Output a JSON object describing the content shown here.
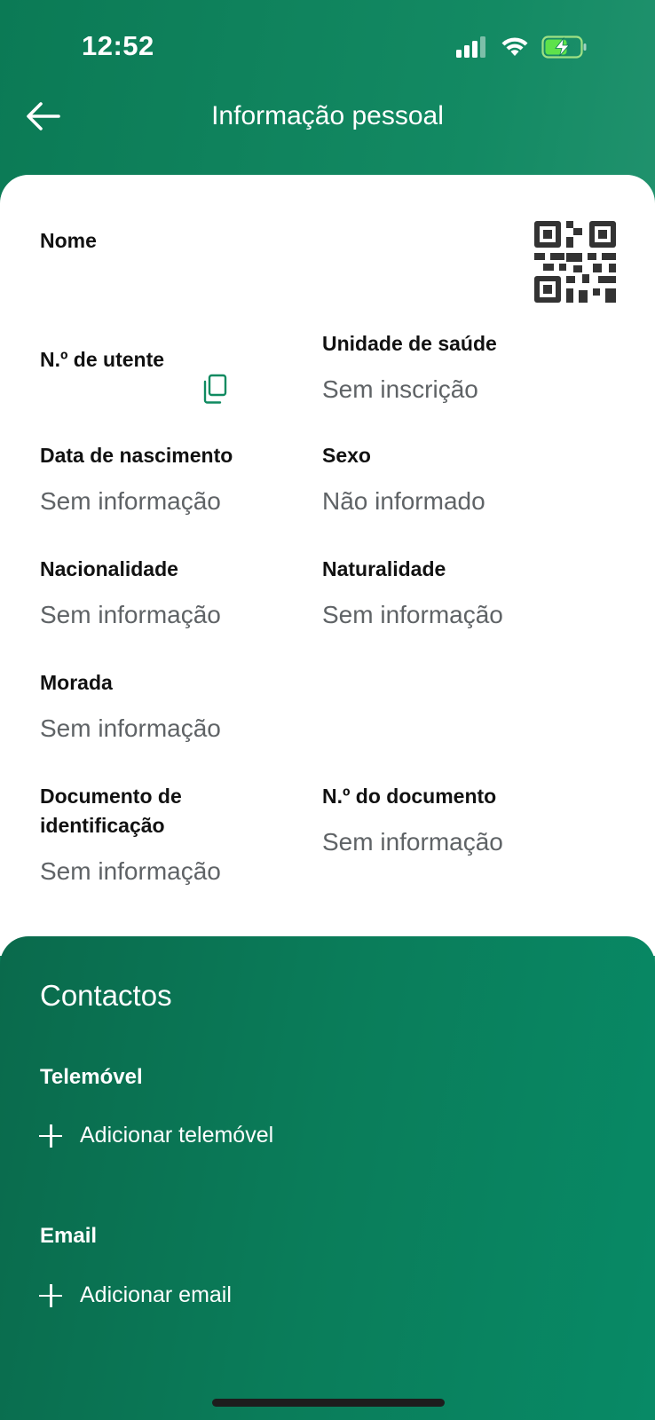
{
  "status_bar": {
    "time": "12:52",
    "icons": [
      "signal-icon",
      "wifi-icon",
      "battery-charging-icon"
    ]
  },
  "header": {
    "title": "Informação pessoal",
    "back_icon": "arrow-left-icon"
  },
  "personal": {
    "name": {
      "label": "Nome"
    },
    "utente": {
      "label": "N.º de utente"
    },
    "health_unit": {
      "label": "Unidade de saúde",
      "value": "Sem inscrição"
    },
    "birth_date": {
      "label": "Data de nascimento",
      "value": "Sem informação"
    },
    "sex": {
      "label": "Sexo",
      "value": "Não informado"
    },
    "nationality": {
      "label": "Nacionalidade",
      "value": "Sem informação"
    },
    "birthplace": {
      "label": "Naturalidade",
      "value": "Sem informação"
    },
    "address": {
      "label": "Morada",
      "value": "Sem informação"
    },
    "id_document": {
      "label": "Documento de identificação",
      "value": "Sem informação"
    },
    "doc_number": {
      "label": "N.º do documento",
      "value": "Sem informação"
    }
  },
  "contacts": {
    "title": "Contactos",
    "phone": {
      "label": "Telemóvel",
      "action": "Adicionar telemóvel"
    },
    "email": {
      "label": "Email",
      "action": "Adicionar email"
    }
  },
  "colors": {
    "primary_green": "#0b7a55",
    "accent_copy": "#0f8a60"
  }
}
